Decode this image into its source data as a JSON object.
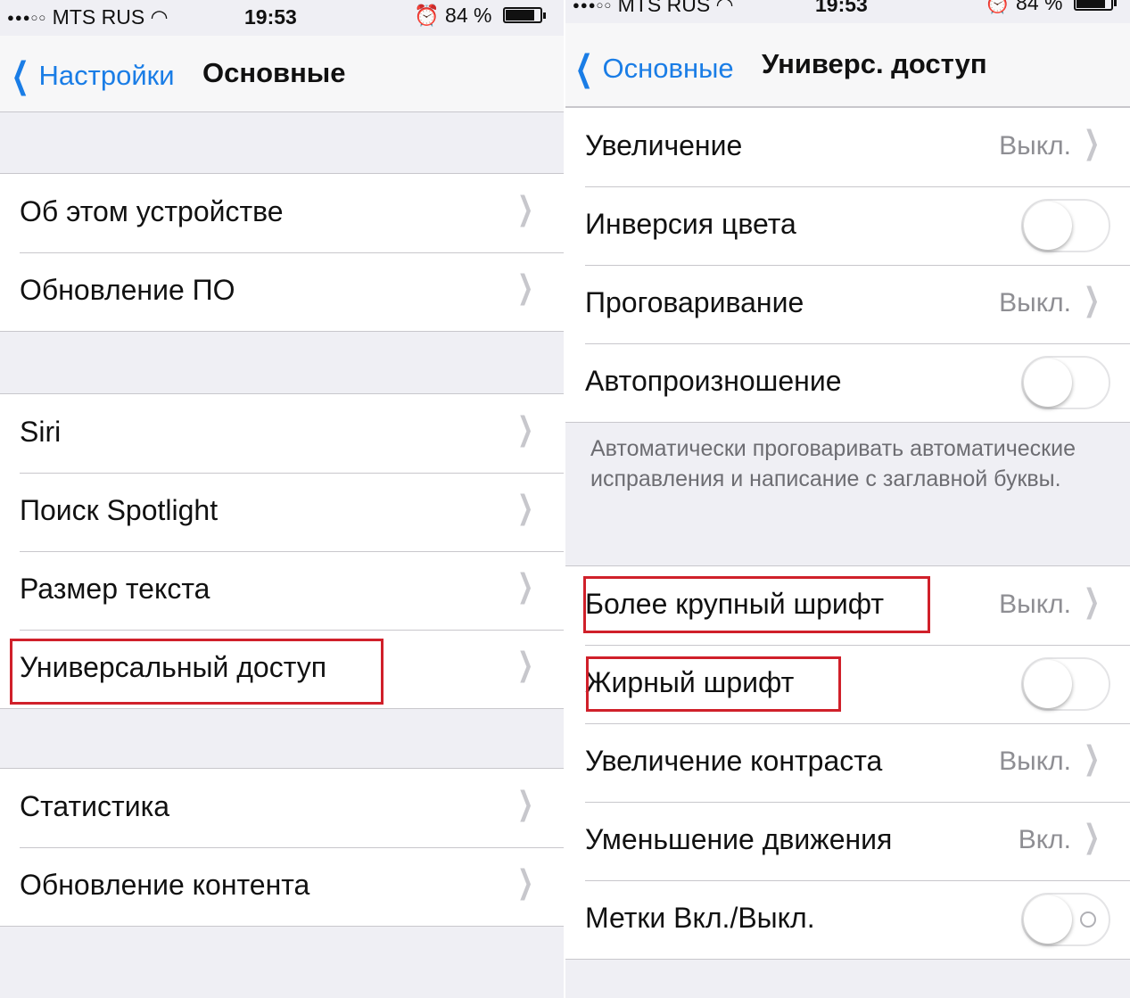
{
  "left": {
    "status": {
      "carrier": "MTS RUS",
      "signal_glyph": "●●●○○",
      "time": "19:53",
      "battery": "84 %",
      "battery_level": 0.84
    },
    "nav": {
      "back_label": "Настройки",
      "title": "Основные"
    },
    "group1": [
      {
        "label": "Об этом устройстве"
      },
      {
        "label": "Обновление ПО"
      }
    ],
    "group2": [
      {
        "label": "Siri"
      },
      {
        "label": "Поиск Spotlight"
      },
      {
        "label": "Размер текста"
      },
      {
        "label": "Универсальный доступ",
        "highlighted": true
      }
    ],
    "group3": [
      {
        "label": "Статистика"
      },
      {
        "label": "Обновление контента"
      }
    ]
  },
  "right": {
    "status": {
      "carrier": "MTS RUS",
      "signal_glyph": "●●●○○",
      "time": "19:53",
      "battery": "84 %",
      "battery_level": 0.84
    },
    "nav": {
      "back_label": "Основные",
      "title": "Универс. доступ"
    },
    "group1": [
      {
        "label": "Увеличение",
        "value": "Выкл."
      },
      {
        "label": "Инверсия цвета",
        "toggle": false
      },
      {
        "label": "Проговаривание",
        "value": "Выкл."
      },
      {
        "label": "Автопроизношение",
        "toggle": false
      }
    ],
    "footer": "Автоматически проговаривать автоматические исправления и написание с заглавной буквы.",
    "group2": [
      {
        "label": "Более крупный шрифт",
        "value": "Выкл.",
        "highlighted": true
      },
      {
        "label": "Жирный шрифт",
        "toggle": false,
        "highlighted": true
      },
      {
        "label": "Увеличение контраста",
        "value": "Выкл."
      },
      {
        "label": "Уменьшение движения",
        "value": "Вкл."
      },
      {
        "label": "Метки Вкл./Выкл.",
        "toggle": false
      }
    ]
  },
  "colors": {
    "accent": "#1a7de6",
    "highlight": "#d0202a",
    "background": "#efeff4"
  },
  "icons": {
    "back": "chevron-left-icon",
    "disclosure": "chevron-right-icon",
    "wifi": "wifi-icon",
    "alarm": "alarm-icon",
    "battery": "battery-icon"
  }
}
